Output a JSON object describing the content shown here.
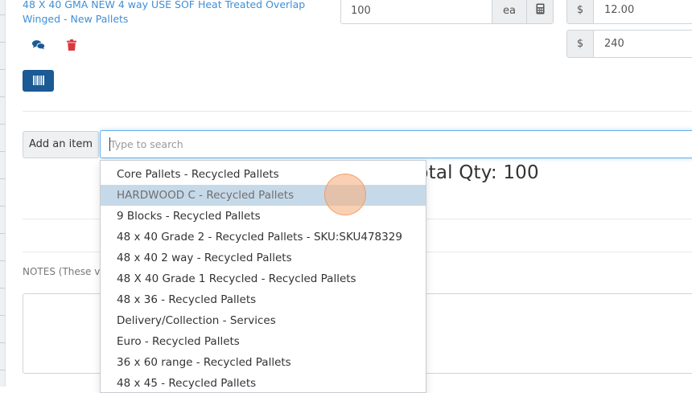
{
  "line_item": {
    "name": "48 X 40 GMA NEW 4 way USE SOF Heat Treated Overlap Winged - New Pallets",
    "quantity": "100",
    "unit": "ea",
    "currency_symbol": "$",
    "unit_price": "12.00",
    "line_total": "240"
  },
  "add_item": {
    "button_label": "Add an item",
    "search_placeholder": "Type to search",
    "search_value": ""
  },
  "summary": {
    "total_qty_text": "Total Qty: 100"
  },
  "notes": {
    "label": "NOTES (These v"
  },
  "dropdown": {
    "highlighted_index": 1,
    "items": [
      "Core Pallets - Recycled Pallets",
      "HARDWOOD C - Recycled Pallets",
      "9 Blocks - Recycled Pallets",
      "48 x 40 Grade 2 - Recycled Pallets - SKU:SKU478329",
      "48 x 40 2 way - Recycled Pallets",
      "48 X 40 Grade 1 Recycled - Recycled Pallets",
      "48 x 36 - Recycled Pallets",
      "Delivery/Collection - Services",
      "Euro - Recycled Pallets",
      "36 x 60 range - Recycled Pallets",
      "48 x 45 - Recycled Pallets"
    ]
  },
  "colors": {
    "link": "#3f8fd6",
    "primary_button": "#1b5a94",
    "delete_icon": "#d9393f",
    "comment_icon": "#1b5a94",
    "highlight": "#c6d9e9",
    "focus_border": "#66afe9"
  },
  "icons": [
    "comments-icon",
    "trash-icon",
    "barcode-icon",
    "calculator-icon"
  ]
}
